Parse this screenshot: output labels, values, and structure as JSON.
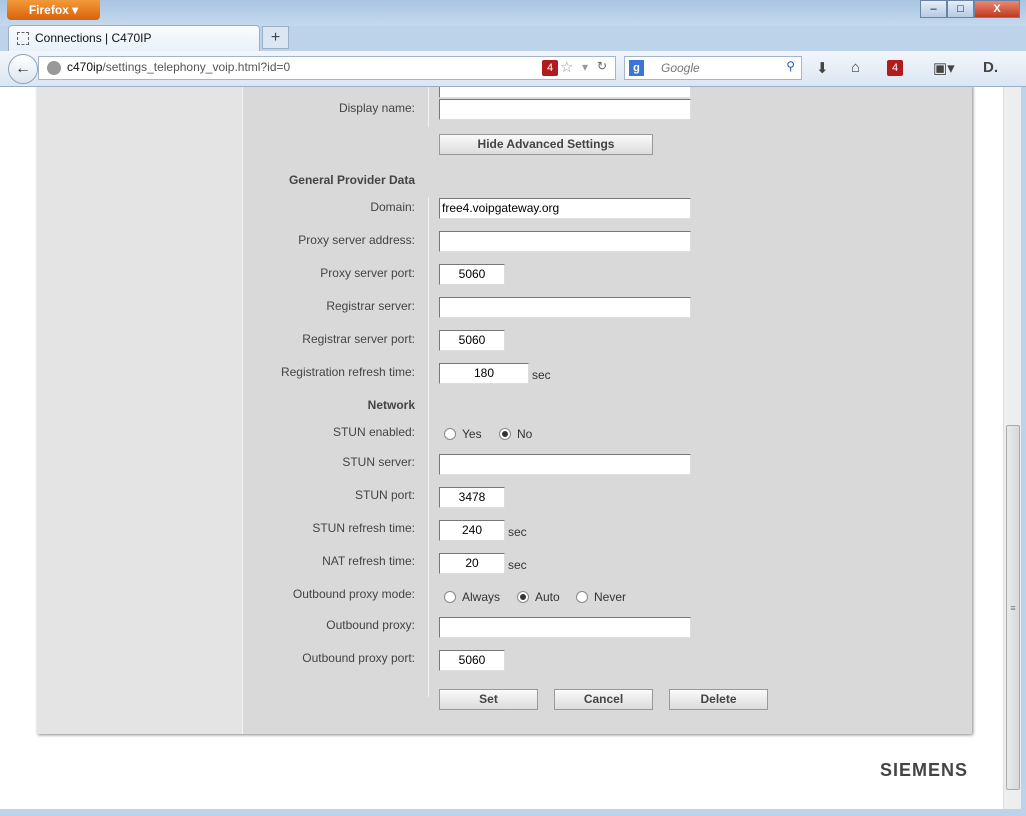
{
  "browser": {
    "menu_label": "Firefox",
    "tab_title": "Connections | C470IP",
    "url_host": "c470ip",
    "url_path": "/settings_telephony_voip.html?id=0",
    "badge": "4",
    "search_placeholder": "Google",
    "search_engine": "g"
  },
  "form": {
    "display_name_label": "Display name:",
    "display_name": "",
    "advanced_button": "Hide Advanced Settings",
    "general_section": "General Provider Data",
    "domain_label": "Domain:",
    "domain": "free4.voipgateway.org",
    "proxy_addr_label": "Proxy server address:",
    "proxy_addr": "",
    "proxy_port_label": "Proxy server port:",
    "proxy_port": "5060",
    "registrar_label": "Registrar server:",
    "registrar": "",
    "registrar_port_label": "Registrar server port:",
    "registrar_port": "5060",
    "reg_refresh_label": "Registration refresh time:",
    "reg_refresh": "180",
    "sec": "sec",
    "network_section": "Network",
    "stun_enabled_label": "STUN enabled:",
    "yes": "Yes",
    "no": "No",
    "stun_enabled": "No",
    "stun_server_label": "STUN server:",
    "stun_server": "",
    "stun_port_label": "STUN port:",
    "stun_port": "3478",
    "stun_refresh_label": "STUN refresh time:",
    "stun_refresh": "240",
    "nat_refresh_label": "NAT refresh time:",
    "nat_refresh": "20",
    "outbound_mode_label": "Outbound proxy mode:",
    "always": "Always",
    "auto": "Auto",
    "never": "Never",
    "outbound_mode": "Auto",
    "outbound_proxy_label": "Outbound proxy:",
    "outbound_proxy": "",
    "outbound_port_label": "Outbound proxy port:",
    "outbound_port": "5060",
    "set": "Set",
    "cancel": "Cancel",
    "delete": "Delete"
  },
  "brand": "SIEMENS"
}
